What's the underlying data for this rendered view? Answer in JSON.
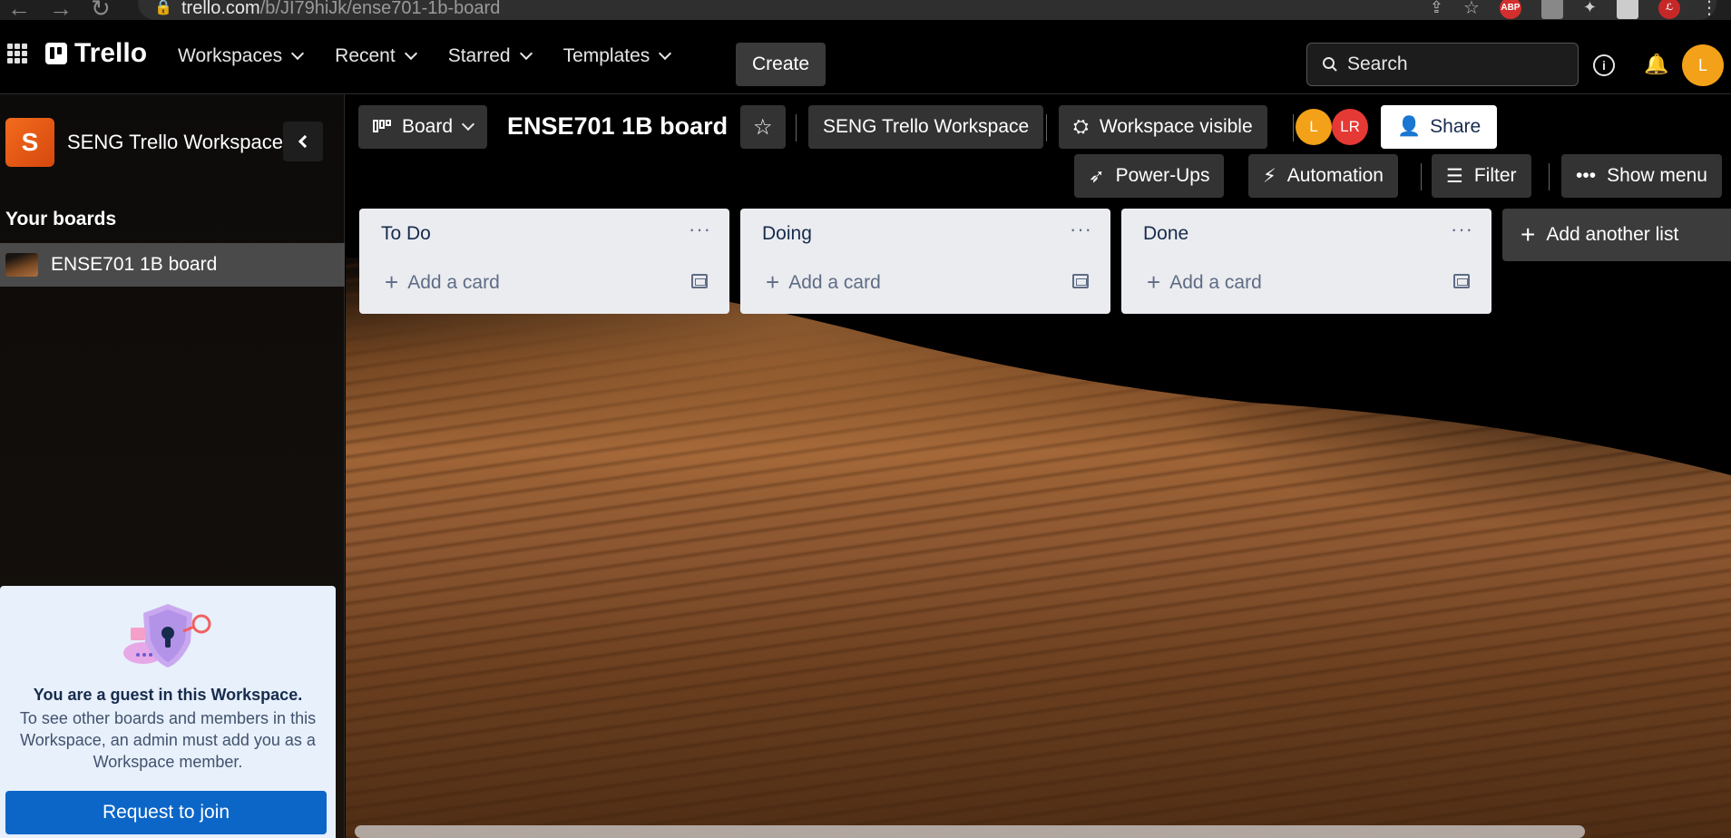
{
  "browser": {
    "url_host": "trello.com",
    "url_path": "/b/JI79hiJk/ense701-1b-board",
    "ext_abp": "ABP"
  },
  "header": {
    "logo_text": "Trello",
    "nav": [
      "Workspaces",
      "Recent",
      "Starred",
      "Templates"
    ],
    "create_label": "Create",
    "search_placeholder": "Search",
    "avatar_initial": "L"
  },
  "sidebar": {
    "workspace_initial": "S",
    "workspace_name": "SENG Trello Workspace",
    "your_boards_label": "Your boards",
    "boards": [
      {
        "label": "ENSE701 1B board"
      }
    ],
    "guest": {
      "title": "You are a guest in this Workspace.",
      "description": "To see other boards and members in this Workspace, an admin must add you as a Workspace member.",
      "button": "Request to join"
    }
  },
  "board": {
    "view_label": "Board",
    "title": "ENSE701 1B board",
    "workspace_label": "SENG Trello Workspace",
    "visibility_label": "Workspace visible",
    "members": [
      {
        "initials": "L",
        "color": "#f2a118"
      },
      {
        "initials": "LR",
        "color": "#e53935"
      }
    ],
    "share_label": "Share",
    "powerups_label": "Power-Ups",
    "automation_label": "Automation",
    "filter_label": "Filter",
    "show_menu_label": "Show menu",
    "lists": [
      {
        "title": "To Do",
        "add_card": "Add a card"
      },
      {
        "title": "Doing",
        "add_card": "Add a card"
      },
      {
        "title": "Done",
        "add_card": "Add a card"
      }
    ],
    "add_list_label": "Add another list"
  },
  "colors": {
    "accent_blue": "#0c66c8",
    "workspace_orange": "#f26b1d",
    "list_bg": "#ebecf0"
  }
}
